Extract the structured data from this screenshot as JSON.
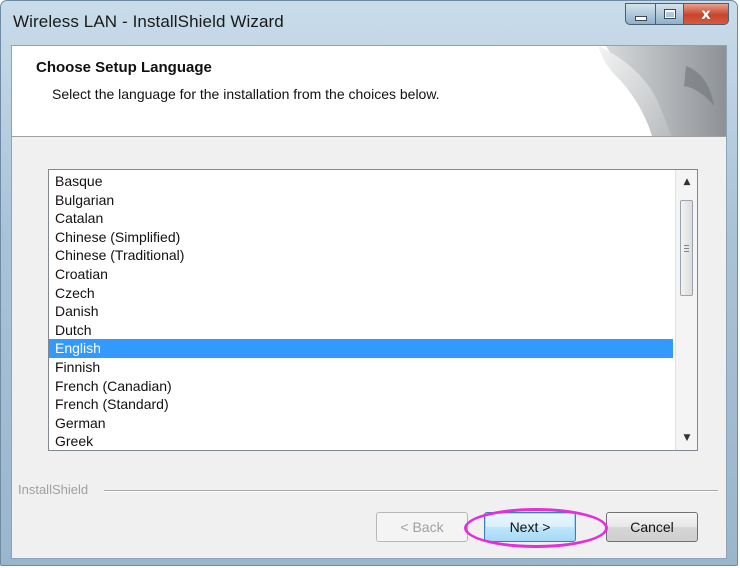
{
  "window": {
    "title": "Wireless LAN - InstallShield Wizard",
    "close_glyph": "x"
  },
  "header": {
    "title": "Choose Setup Language",
    "subtitle": "Select the language for the installation from the choices below."
  },
  "language_list": {
    "items": [
      "Basque",
      "Bulgarian",
      "Catalan",
      "Chinese (Simplified)",
      "Chinese (Traditional)",
      "Croatian",
      "Czech",
      "Danish",
      "Dutch",
      "English",
      "Finnish",
      "French (Canadian)",
      "French (Standard)",
      "German",
      "Greek"
    ],
    "selected": "English"
  },
  "footer": {
    "brand": "InstallShield"
  },
  "buttons": {
    "back_label": "< Back",
    "next_label": "Next >",
    "cancel_label": "Cancel"
  },
  "colors": {
    "selection": "#3399ff",
    "highlight_ring": "#e42fd8"
  }
}
